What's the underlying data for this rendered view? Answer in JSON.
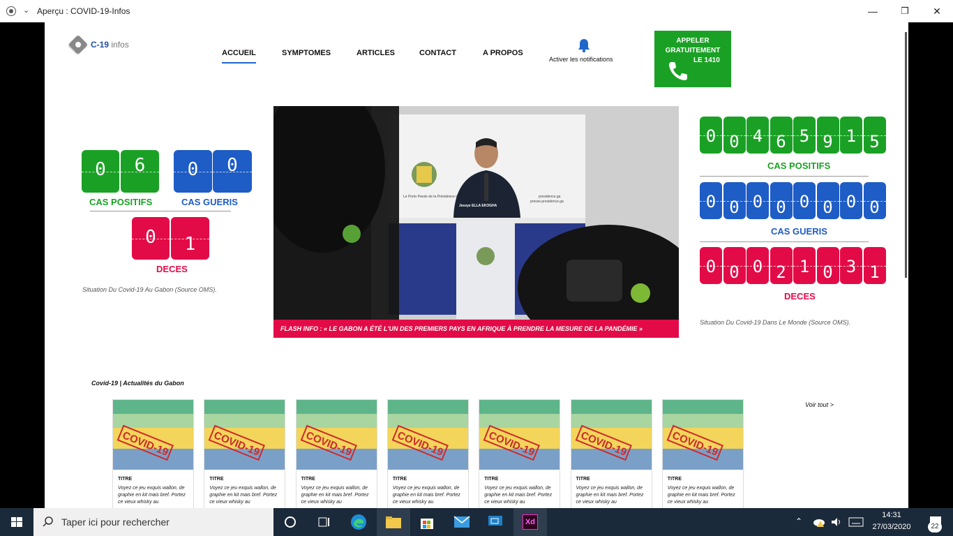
{
  "window": {
    "title": "Aperçu : COVID-19-Infos",
    "minimize": "—",
    "maximize": "❐",
    "close": "✕"
  },
  "header": {
    "logo": {
      "brand": "C-19",
      "suffix": "infos"
    },
    "nav": [
      "ACCUEIL",
      "SYMPTOMES",
      "ARTICLES",
      "CONTACT",
      "A PROPOS"
    ],
    "active_nav": "ACCUEIL",
    "notifications_label": "Activer les notifications",
    "call": {
      "line1": "APPELER",
      "line2": "GRATUITEMENT",
      "line3": "LE 1410"
    }
  },
  "gabon": {
    "positifs": {
      "digits": [
        "0",
        "6"
      ],
      "label": "CAS POSITIFS"
    },
    "gueris": {
      "digits": [
        "0",
        "0"
      ],
      "label": "CAS GUERIS"
    },
    "deces": {
      "digits": [
        "0",
        "1"
      ],
      "label": "DECES"
    },
    "caption": "Situation Du Covid-19 Au Gabon (Source OMS)."
  },
  "monde": {
    "positifs": {
      "digits": [
        "0",
        "0",
        "4",
        "6",
        "5",
        "9",
        "1",
        "5"
      ],
      "label": "CAS POSITIFS"
    },
    "gueris": {
      "digits": [
        "0",
        "0",
        "0",
        "0",
        "0",
        "0",
        "0",
        "0"
      ],
      "label": "CAS GUERIS"
    },
    "deces": {
      "digits": [
        "0",
        "0",
        "0",
        "2",
        "1",
        "0",
        "3",
        "1"
      ],
      "label": "DECES"
    },
    "caption": "Situation Du Covid-19 Dans Le Monde (Source OMS)."
  },
  "hero": {
    "flash": "FLASH INFO : « LE GABON A ÉTÉ L'UN DES PREMIERS PAYS EN AFRIQUE À PRENDRE LA MESURE DE LA PANDÉMIE »",
    "banner_small": "Le Porte-Parole de la Présidence de la République",
    "banner_site": "presidence.ga",
    "banner_press": "presse.presidence.ga",
    "speaker": "Jessye ELLA EKOGHA"
  },
  "news": {
    "section_title": "Covid-19 | Actualités du Gabon",
    "see_all": "Voir tout >",
    "cards": [
      {
        "stamp": "COVID-19",
        "title": "TITRE",
        "text": "Voyez ce jeu exquis wallon, de graphie en kit mais bref. Portez ce vieux whisky au"
      },
      {
        "stamp": "COVID-19",
        "title": "TITRE",
        "text": "Voyez ce jeu exquis wallon, de graphie en kit mais bref. Portez ce vieux whisky au"
      },
      {
        "stamp": "COVID-19",
        "title": "TITRE",
        "text": "Voyez ce jeu exquis wallon, de graphie en kit mais bref. Portez ce vieux whisky au"
      },
      {
        "stamp": "COVID-19",
        "title": "TITRE",
        "text": "Voyez ce jeu exquis wallon, de graphie en kit mais bref. Portez ce vieux whisky au"
      },
      {
        "stamp": "COVID-19",
        "title": "TITRE",
        "text": "Voyez ce jeu exquis wallon, de graphie en kit mais bref. Portez ce vieux whisky au"
      },
      {
        "stamp": "COVID-19",
        "title": "TITRE",
        "text": "Voyez ce jeu exquis wallon, de graphie en kit mais bref. Portez ce vieux whisky au"
      },
      {
        "stamp": "COVID-19",
        "title": "TITRE",
        "text": "Voyez ce jeu exquis wallon, de graphie en kit mais bref. Portez ce vieux whisky au"
      }
    ]
  },
  "taskbar": {
    "search_placeholder": "Taper ici pour rechercher",
    "time": "14:31",
    "date": "27/03/2020",
    "notifications": "22",
    "xd_label": "Xd"
  },
  "colors": {
    "green": "#1aa125",
    "blue": "#1e5cc6",
    "red": "#e30b47",
    "nav_active": "#1f66c9"
  }
}
